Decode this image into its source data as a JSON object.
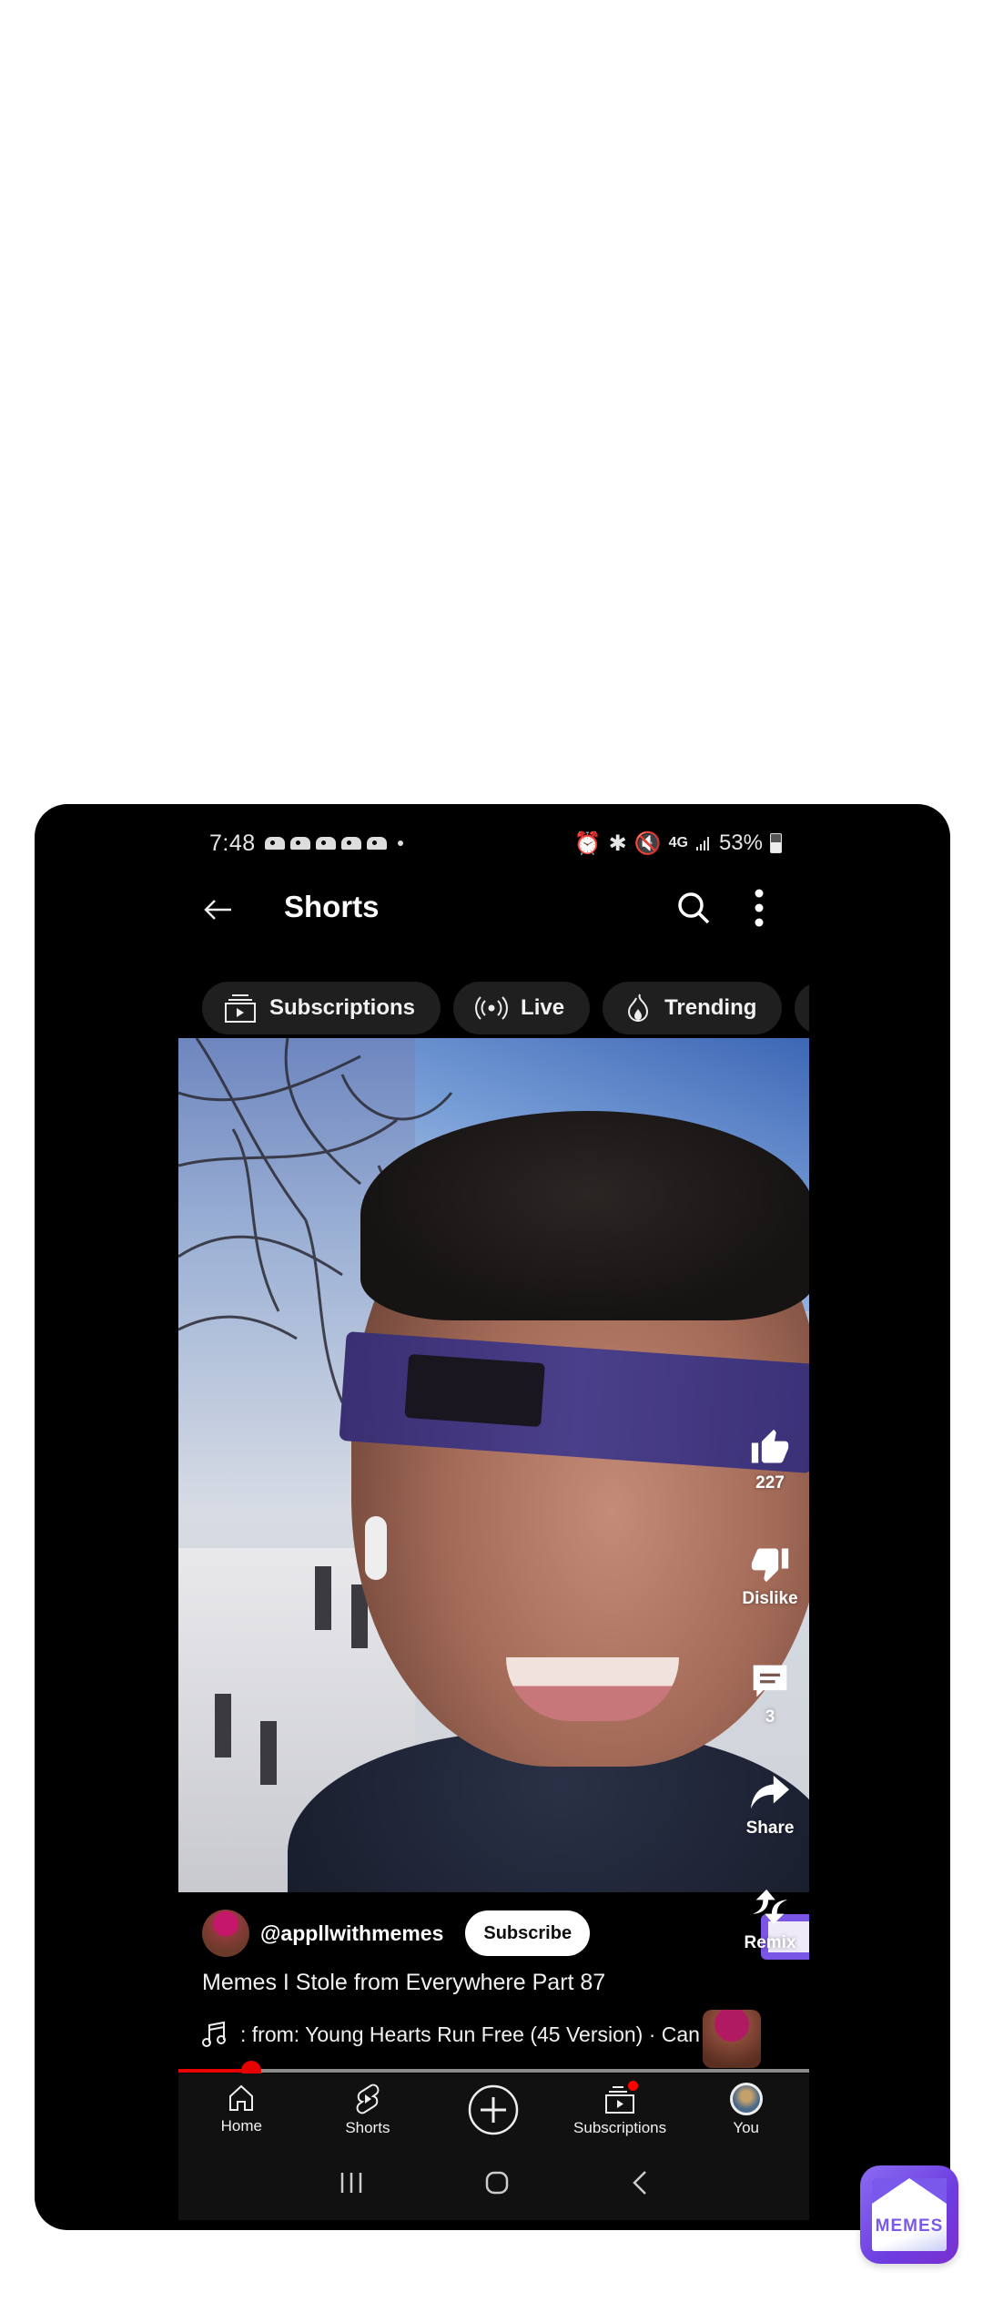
{
  "status_bar": {
    "time": "7:48",
    "notification_count": 5,
    "icons": [
      "alarm-icon",
      "bluetooth-icon",
      "mute-icon",
      "4g-icon",
      "signal-icon"
    ],
    "network": "4G",
    "battery": "53%"
  },
  "header": {
    "title": "Shorts",
    "back_icon": "arrow-left-icon",
    "search_icon": "search-icon",
    "more_icon": "more-vert-icon"
  },
  "chips": [
    {
      "label": "Subscriptions",
      "icon": "subscriptions-icon"
    },
    {
      "label": "Live",
      "icon": "live-icon"
    },
    {
      "label": "Trending",
      "icon": "trending-icon"
    }
  ],
  "actions": {
    "like": {
      "label": "227",
      "icon": "thumb-up-icon"
    },
    "dislike": {
      "label": "Dislike",
      "icon": "thumb-down-icon"
    },
    "comments": {
      "label": "3",
      "icon": "comment-icon"
    },
    "share": {
      "label": "Share",
      "icon": "share-icon"
    },
    "remix": {
      "label": "Remix",
      "icon": "remix-icon"
    }
  },
  "video": {
    "channel_handle": "@appllwithmemes",
    "subscribe_label": "Subscribe",
    "title": "Memes I Stole from Everywhere Part 87",
    "music": ": from: Young Hearts Run Free (45 Version) · Can",
    "progress_fraction": 0.115
  },
  "bottom_nav": [
    {
      "label": "Home",
      "icon": "home-icon"
    },
    {
      "label": "Shorts",
      "icon": "shorts-icon"
    },
    {
      "label": "",
      "icon": "create-plus-icon"
    },
    {
      "label": "Subscriptions",
      "icon": "subscriptions-icon",
      "has_badge": true
    },
    {
      "label": "You",
      "icon": "avatar"
    }
  ],
  "system_nav": [
    "recents-icon",
    "home-circle-icon",
    "back-icon"
  ],
  "watermark": {
    "label": "MEMES"
  },
  "colors": {
    "accent_red": "#e60000",
    "brand_purple": "#7a58ec"
  }
}
